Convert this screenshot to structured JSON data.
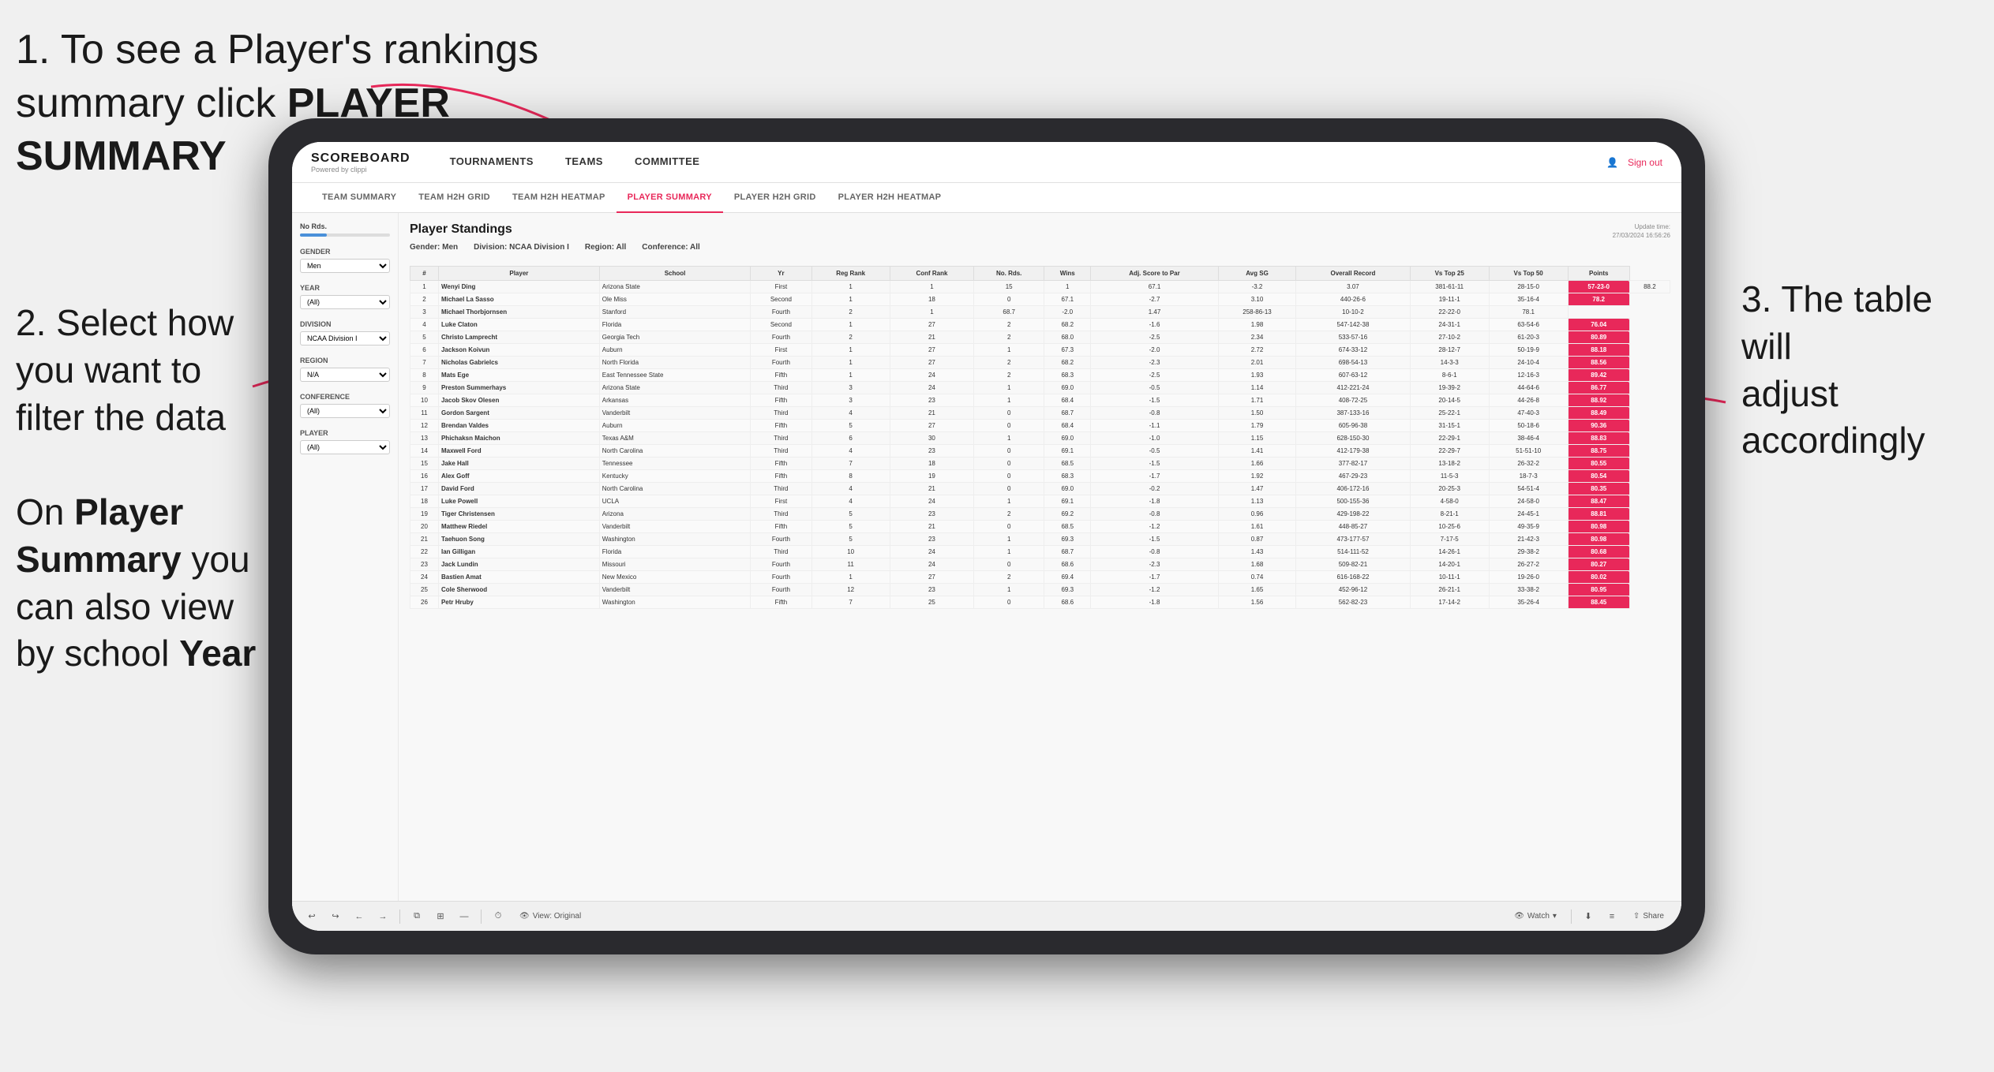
{
  "annotations": {
    "top_left_line1": "1. To see a Player's rankings",
    "top_left_line2": "summary click ",
    "top_left_bold": "PLAYER SUMMARY",
    "mid_left_line1": "2. Select how",
    "mid_left_line2": "you want to",
    "mid_left_line3": "filter the data",
    "bottom_left_line1": "On ",
    "bottom_left_bold1": "Player",
    "bottom_left_line2": "Summary",
    "bottom_left_suffix": " you",
    "bottom_left_line3": "can also view",
    "bottom_left_line4": "by school ",
    "bottom_left_bold2": "Year",
    "right_line1": "3. The table will",
    "right_line2": "adjust accordingly"
  },
  "app": {
    "logo": "SCOREBOARD",
    "logo_sub": "Powered by clippi",
    "sign_out": "Sign out"
  },
  "nav": {
    "items": [
      "TOURNAMENTS",
      "TEAMS",
      "COMMITTEE"
    ]
  },
  "sub_nav": {
    "items": [
      "TEAM SUMMARY",
      "TEAM H2H GRID",
      "TEAM H2H HEATMAP",
      "PLAYER SUMMARY",
      "PLAYER H2H GRID",
      "PLAYER H2H HEATMAP"
    ],
    "active": "PLAYER SUMMARY"
  },
  "filters": {
    "no_rds_label": "No Rds.",
    "gender_label": "Gender",
    "gender_value": "Men",
    "year_label": "Year",
    "year_value": "(All)",
    "division_label": "Division",
    "division_value": "NCAA Division I",
    "region_label": "Region",
    "region_value": "N/A",
    "conference_label": "Conference",
    "conference_value": "(All)",
    "player_label": "Player",
    "player_value": "(All)"
  },
  "table": {
    "title": "Player Standings",
    "update_time": "Update time:\n27/03/2024 16:56:26",
    "filter_gender": "Gender: Men",
    "filter_division": "Division: NCAA Division I",
    "filter_region": "Region: All",
    "filter_conference": "Conference: All",
    "columns": [
      "#",
      "Player",
      "School",
      "Yr",
      "Reg Rank",
      "Conf Rank",
      "No. Rds.",
      "Wins",
      "Adj. Score to Par",
      "Avg SG",
      "Overall Record",
      "Vs Top 25",
      "Vs Top 50",
      "Points"
    ],
    "rows": [
      [
        "1",
        "Wenyi Ding",
        "Arizona State",
        "First",
        "1",
        "1",
        "15",
        "1",
        "67.1",
        "-3.2",
        "3.07",
        "381-61-11",
        "28-15-0",
        "57-23-0",
        "88.2"
      ],
      [
        "2",
        "Michael La Sasso",
        "Ole Miss",
        "Second",
        "1",
        "18",
        "0",
        "67.1",
        "-2.7",
        "3.10",
        "440-26-6",
        "19-11-1",
        "35-16-4",
        "78.2"
      ],
      [
        "3",
        "Michael Thorbjornsen",
        "Stanford",
        "Fourth",
        "2",
        "1",
        "68.7",
        "-2.0",
        "1.47",
        "258-86-13",
        "10-10-2",
        "22-22-0",
        "78.1"
      ],
      [
        "4",
        "Luke Claton",
        "Florida",
        "Second",
        "1",
        "27",
        "2",
        "68.2",
        "-1.6",
        "1.98",
        "547-142-38",
        "24-31-1",
        "63-54-6",
        "76.04"
      ],
      [
        "5",
        "Christo Lamprecht",
        "Georgia Tech",
        "Fourth",
        "2",
        "21",
        "2",
        "68.0",
        "-2.5",
        "2.34",
        "533-57-16",
        "27-10-2",
        "61-20-3",
        "80.89"
      ],
      [
        "6",
        "Jackson Koivun",
        "Auburn",
        "First",
        "1",
        "27",
        "1",
        "67.3",
        "-2.0",
        "2.72",
        "674-33-12",
        "28-12-7",
        "50-19-9",
        "88.18"
      ],
      [
        "7",
        "Nicholas Gabrielcs",
        "North Florida",
        "Fourth",
        "1",
        "27",
        "2",
        "68.2",
        "-2.3",
        "2.01",
        "698-54-13",
        "14-3-3",
        "24-10-4",
        "88.56"
      ],
      [
        "8",
        "Mats Ege",
        "East Tennessee State",
        "Fifth",
        "1",
        "24",
        "2",
        "68.3",
        "-2.5",
        "1.93",
        "607-63-12",
        "8-6-1",
        "12-16-3",
        "89.42"
      ],
      [
        "9",
        "Preston Summerhays",
        "Arizona State",
        "Third",
        "3",
        "24",
        "1",
        "69.0",
        "-0.5",
        "1.14",
        "412-221-24",
        "19-39-2",
        "44-64-6",
        "86.77"
      ],
      [
        "10",
        "Jacob Skov Olesen",
        "Arkansas",
        "Fifth",
        "3",
        "23",
        "1",
        "68.4",
        "-1.5",
        "1.71",
        "408-72-25",
        "20-14-5",
        "44-26-8",
        "88.92"
      ],
      [
        "11",
        "Gordon Sargent",
        "Vanderbilt",
        "Third",
        "4",
        "21",
        "0",
        "68.7",
        "-0.8",
        "1.50",
        "387-133-16",
        "25-22-1",
        "47-40-3",
        "88.49"
      ],
      [
        "12",
        "Brendan Valdes",
        "Auburn",
        "Fifth",
        "5",
        "27",
        "0",
        "68.4",
        "-1.1",
        "1.79",
        "605-96-38",
        "31-15-1",
        "50-18-6",
        "90.36"
      ],
      [
        "13",
        "Phichaksn Maichon",
        "Texas A&M",
        "Third",
        "6",
        "30",
        "1",
        "69.0",
        "-1.0",
        "1.15",
        "628-150-30",
        "22-29-1",
        "38-46-4",
        "88.83"
      ],
      [
        "14",
        "Maxwell Ford",
        "North Carolina",
        "Third",
        "4",
        "23",
        "0",
        "69.1",
        "-0.5",
        "1.41",
        "412-179-38",
        "22-29-7",
        "51-51-10",
        "88.75"
      ],
      [
        "15",
        "Jake Hall",
        "Tennessee",
        "Fifth",
        "7",
        "18",
        "0",
        "68.5",
        "-1.5",
        "1.66",
        "377-82-17",
        "13-18-2",
        "26-32-2",
        "80.55"
      ],
      [
        "16",
        "Alex Goff",
        "Kentucky",
        "Fifth",
        "8",
        "19",
        "0",
        "68.3",
        "-1.7",
        "1.92",
        "467-29-23",
        "11-5-3",
        "18-7-3",
        "80.54"
      ],
      [
        "17",
        "David Ford",
        "North Carolina",
        "Third",
        "4",
        "21",
        "0",
        "69.0",
        "-0.2",
        "1.47",
        "406-172-16",
        "20-25-3",
        "54-51-4",
        "80.35"
      ],
      [
        "18",
        "Luke Powell",
        "UCLA",
        "First",
        "4",
        "24",
        "1",
        "69.1",
        "-1.8",
        "1.13",
        "500-155-36",
        "4-58-0",
        "24-58-0",
        "88.47"
      ],
      [
        "19",
        "Tiger Christensen",
        "Arizona",
        "Third",
        "5",
        "23",
        "2",
        "69.2",
        "-0.8",
        "0.96",
        "429-198-22",
        "8-21-1",
        "24-45-1",
        "88.81"
      ],
      [
        "20",
        "Matthew Riedel",
        "Vanderbilt",
        "Fifth",
        "5",
        "21",
        "0",
        "68.5",
        "-1.2",
        "1.61",
        "448-85-27",
        "10-25-6",
        "49-35-9",
        "80.98"
      ],
      [
        "21",
        "Taehuon Song",
        "Washington",
        "Fourth",
        "5",
        "23",
        "1",
        "69.3",
        "-1.5",
        "0.87",
        "473-177-57",
        "7-17-5",
        "21-42-3",
        "80.98"
      ],
      [
        "22",
        "Ian Gilligan",
        "Florida",
        "Third",
        "10",
        "24",
        "1",
        "68.7",
        "-0.8",
        "1.43",
        "514-111-52",
        "14-26-1",
        "29-38-2",
        "80.68"
      ],
      [
        "23",
        "Jack Lundin",
        "Missouri",
        "Fourth",
        "11",
        "24",
        "0",
        "68.6",
        "-2.3",
        "1.68",
        "509-82-21",
        "14-20-1",
        "26-27-2",
        "80.27"
      ],
      [
        "24",
        "Bastien Amat",
        "New Mexico",
        "Fourth",
        "1",
        "27",
        "2",
        "69.4",
        "-1.7",
        "0.74",
        "616-168-22",
        "10-11-1",
        "19-26-0",
        "80.02"
      ],
      [
        "25",
        "Cole Sherwood",
        "Vanderbilt",
        "Fourth",
        "12",
        "23",
        "1",
        "69.3",
        "-1.2",
        "1.65",
        "452-96-12",
        "26-21-1",
        "33-38-2",
        "80.95"
      ],
      [
        "26",
        "Petr Hruby",
        "Washington",
        "Fifth",
        "7",
        "25",
        "0",
        "68.6",
        "-1.8",
        "1.56",
        "562-82-23",
        "17-14-2",
        "35-26-4",
        "88.45"
      ]
    ]
  },
  "toolbar": {
    "view_label": "View: Original",
    "watch_label": "Watch",
    "share_label": "Share"
  }
}
